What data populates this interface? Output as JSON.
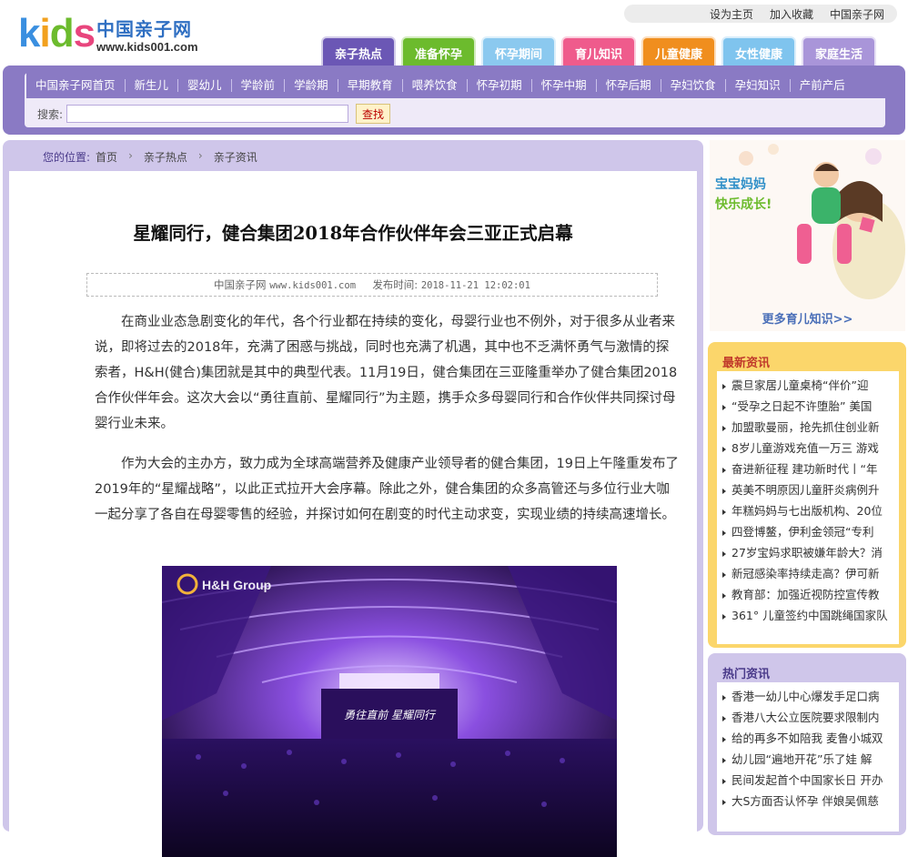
{
  "logo": {
    "kids": "kids",
    "cn": "中国亲子网",
    "url": "www.kids001.com"
  },
  "toplinks": [
    "设为主页",
    "加入收藏",
    "中国亲子网"
  ],
  "tabs": [
    {
      "label": "亲子热点",
      "color": "#6b57b5"
    },
    {
      "label": "准备怀孕",
      "color": "#6cbb2d"
    },
    {
      "label": "怀孕期间",
      "color": "#8bc9ef"
    },
    {
      "label": "育儿知识",
      "color": "#ef5b8c"
    },
    {
      "label": "儿童健康",
      "color": "#f08e1e"
    },
    {
      "label": "女性健康",
      "color": "#7fc4ee"
    },
    {
      "label": "家庭生活",
      "color": "#a995d9"
    }
  ],
  "nav": [
    "中国亲子网首页",
    "新生儿",
    "婴幼儿",
    "学龄前",
    "学龄期",
    "早期教育",
    "喂养饮食",
    "怀孕初期",
    "怀孕中期",
    "怀孕后期",
    "孕妇饮食",
    "孕妇知识",
    "产前产后"
  ],
  "search": {
    "label": "搜索:",
    "placeholder": "",
    "button": "查找"
  },
  "breadcrumb": {
    "prefix": "您的位置:",
    "items": [
      "首页",
      "亲子热点",
      "亲子资讯"
    ]
  },
  "article": {
    "title": "星耀同行，健合集团2018年合作伙伴年会三亚正式启幕",
    "source": "中国亲子网",
    "source_url": "www.kids001.com",
    "date_label": "发布时间:",
    "date": "2018-11-21 12:02:01",
    "paragraphs": [
      "在商业业态急剧变化的年代，各个行业都在持续的变化，母婴行业也不例外，对于很多从业者来说，即将过去的2018年，充满了困惑与挑战，同时也充满了机遇，其中也不乏满怀勇气与激情的探索者，H&H(健合)集团就是其中的典型代表。11月19日，健合集团在三亚隆重举办了健合集团2018合作伙伴年会。这次大会以“勇往直前、星耀同行”为主题，携手众多母婴同行和合作伙伴共同探讨母婴行业未来。",
      "作为大会的主办方，致力成为全球高端营养及健康产业领导者的健合集团，19日上午隆重发布了2019年的“星耀战略”，以此正式拉开大会序幕。除此之外，健合集团的众多高管还与多位行业大咖一起分享了各自在母婴零售的经验，并探讨如何在剧变的时代主动求变，实现业绩的持续高速增长。"
    ],
    "photo_logo": "H&H Group",
    "photo_stage_text": "勇往直前 星耀同行"
  },
  "banner": {
    "line1": "宝宝妈妈",
    "line2": "快乐成长!",
    "more": "更多育儿知识>>"
  },
  "latest": {
    "title": "最新资讯",
    "items": [
      "震旦家居儿童桌椅“伴价”迎",
      "“受孕之日起不许堕胎” 美国",
      "加盟歌曼丽，抢先抓住创业新",
      "8岁儿童游戏充值一万三 游戏",
      "奋进新征程 建功新时代丨“年",
      "英美不明原因儿童肝炎病例升",
      "年糕妈妈与七出版机构、20位",
      "四登博鳌，伊利金领冠“专利",
      "27岁宝妈求职被嫌年龄大？消",
      "新冠感染率持续走高？伊可新",
      "教育部：加强近视防控宣传教",
      "361° 儿童签约中国跳绳国家队"
    ]
  },
  "hot": {
    "title": "热门资讯",
    "items": [
      "香港一幼儿中心爆发手足口病",
      "香港八大公立医院要求限制内",
      "给的再多不如陪我 麦鲁小城双",
      "幼儿园“遍地开花”乐了娃 解",
      "民间发起首个中国家长日 开办",
      "大S方面否认怀孕 伴娘吴佩慈"
    ]
  }
}
